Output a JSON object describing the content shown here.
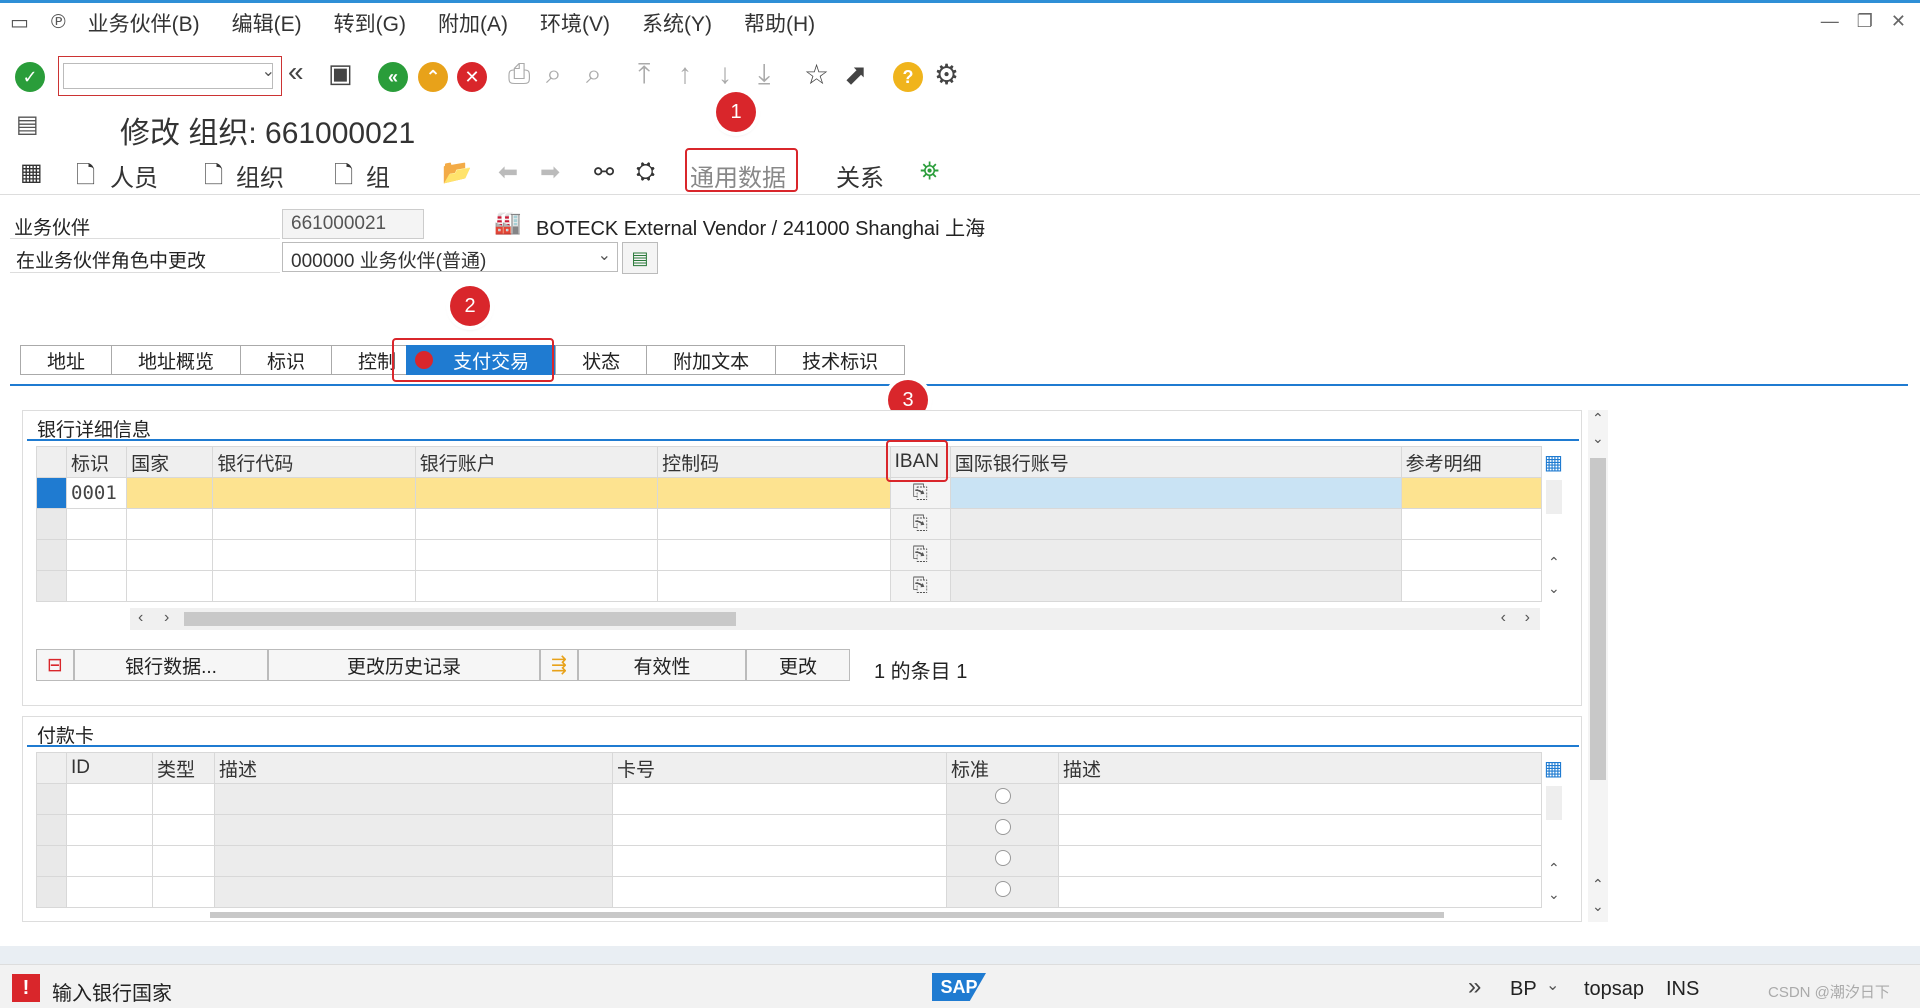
{
  "menu": {
    "items": [
      "业务伙伴(B)",
      "编辑(E)",
      "转到(G)",
      "附加(A)",
      "环境(V)",
      "系统(Y)",
      "帮助(H)"
    ]
  },
  "title": "修改 组织: 661000021",
  "app_toolbar": {
    "person": "人员",
    "organization": "组织",
    "group": "组",
    "general_data": "通用数据",
    "relationships": "关系"
  },
  "header": {
    "bp_label": "业务伙伴",
    "bp_value": "661000021",
    "bp_description": "BOTECK External Vendor / 241000 Shanghai 上海",
    "role_label": "在业务伙伴角色中更改",
    "role_value": "000000 业务伙伴(普通)"
  },
  "annotations": [
    "1",
    "2",
    "3"
  ],
  "tabs": [
    "地址",
    "地址概览",
    "标识",
    "控制",
    "支付交易",
    "状态",
    "附加文本",
    "技术标识"
  ],
  "active_tab": "支付交易",
  "bank": {
    "title": "银行详细信息",
    "columns": [
      "标识",
      "国家",
      "银行代码",
      "银行账户",
      "控制码",
      "IBAN",
      "国际银行账号",
      "参考明细"
    ],
    "rows": [
      {
        "id": "0001",
        "country": "",
        "bank_key": "",
        "account": "",
        "control": "",
        "iban_account": "",
        "ref": ""
      }
    ],
    "buttons": {
      "bank_data": "银行数据...",
      "history": "更改历史记录",
      "validity": "有效性",
      "change": "更改"
    },
    "entries": "1 的条目 1"
  },
  "card": {
    "title": "付款卡",
    "columns": [
      "ID",
      "类型",
      "描述",
      "卡号",
      "标准",
      "描述"
    ]
  },
  "status": {
    "message": "输入银行国家",
    "transaction": "BP",
    "server": "topsap",
    "mode": "INS",
    "watermark": "CSDN @潮汐日下"
  },
  "colors": {
    "accent_blue": "#1f7bd1",
    "highlight_red": "#d9262b",
    "selected_row": "#fde390"
  }
}
